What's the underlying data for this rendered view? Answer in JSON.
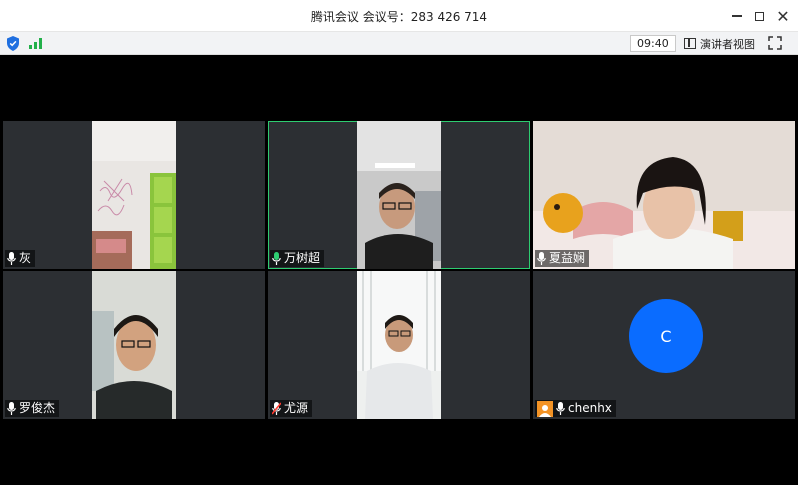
{
  "window": {
    "title": "腾讯会议 会议号：283 426 714",
    "minimize_icon": "minimize-icon",
    "maximize_icon": "maximize-icon",
    "close_icon": "close-icon"
  },
  "toolbar": {
    "security_icon": "shield-icon",
    "signal_icon": "signal-bars-icon",
    "elapsed_time": "09:40",
    "speaker_view_label": "演讲者视图",
    "fullscreen_icon": "fullscreen-icon"
  },
  "colors": {
    "active_speaker_border": "#2ecc71",
    "mic_on": "#2ecc71",
    "avatar_circle": "#0a6cff",
    "avatar_badge": "#f39325",
    "tile_bg": "#2c2f33"
  },
  "participants": [
    {
      "name": "灰",
      "mic": "muted",
      "video": true
    },
    {
      "name": "万树超",
      "mic": "speaking",
      "video": true,
      "active": true
    },
    {
      "name": "夏益娴",
      "mic": "muted",
      "video": true
    },
    {
      "name": "罗俊杰",
      "mic": "muted",
      "video": true
    },
    {
      "name": "尤源",
      "mic": "muted-red",
      "video": true
    },
    {
      "name": "chenhx",
      "mic": "muted",
      "video": false,
      "avatar_letter": "C"
    }
  ]
}
